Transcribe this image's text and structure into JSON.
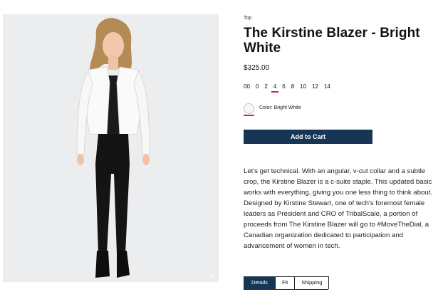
{
  "product": {
    "breadcrumb": "Top",
    "title": "The Kirstine Blazer - Bright White",
    "price": "$325.00",
    "sizes": [
      "00",
      "0",
      "2",
      "4",
      "6",
      "8",
      "10",
      "12",
      "14"
    ],
    "selected_size": "4",
    "color_label": "Color: Bright White",
    "swatch_color": "#f7f7f5",
    "add_to_cart": "Add to Cart",
    "description": "Let's get technical. With an angular, v-cut collar and a subtle crop, the Kirstine Blazer is a c-suite staple. This updated basic works with everything, giving you one less thing to think about. Designed by Kirstine Stewart, one of tech's foremost female leaders as President and CRO of TribalScale, a portion of proceeds from The Kirstine Blazer will go to #MoveTheDial, a Canadian organization dedicated to participation and advancement of women in tech."
  },
  "tabs": [
    {
      "label": "Details",
      "active": true
    },
    {
      "label": "Fit",
      "active": false
    },
    {
      "label": "Shipping",
      "active": false
    }
  ],
  "image": {
    "alt_icon": "zoom-icon",
    "zoom_symbol": "+"
  },
  "colors": {
    "accent": "#173655",
    "selection_underline": "#d7262f",
    "photo_background": "#ecedef"
  }
}
